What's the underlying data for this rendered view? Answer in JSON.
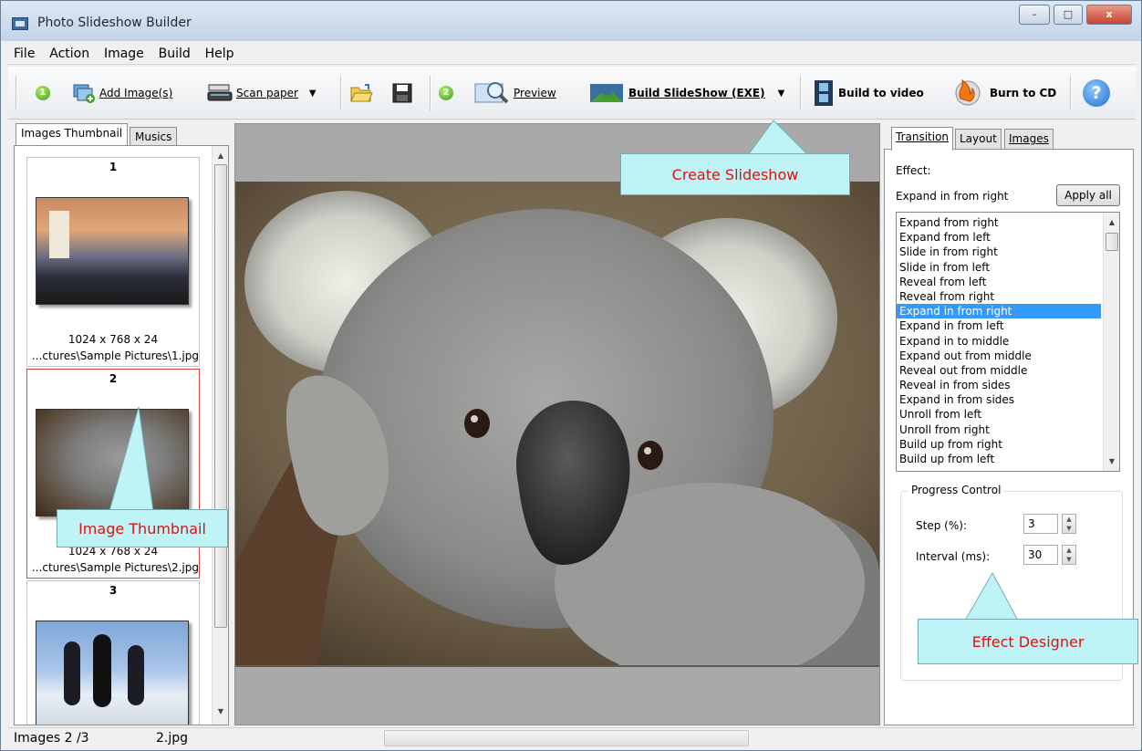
{
  "window": {
    "title": "Photo Slideshow Builder",
    "controls": {
      "minimize": "–",
      "maximize": "□",
      "close": "x"
    }
  },
  "menu": [
    "File",
    "Action",
    "Image",
    "Build",
    "Help"
  ],
  "toolbar": {
    "step1_badge": "1",
    "add_images": "Add Image(s)",
    "scan_paper": "Scan paper",
    "step2_badge": "2",
    "preview": "Preview",
    "build_exe": "Build SlideShow (EXE)",
    "build_video": "Build to video",
    "burn_cd": "Burn to CD",
    "help": "?"
  },
  "left_panel": {
    "tabs": [
      "Images Thumbnail",
      "Musics"
    ],
    "thumbnails": [
      {
        "num": "1",
        "size": "1024 x 768 x 24",
        "path": "...ctures\\Sample Pictures\\1.jpg"
      },
      {
        "num": "2",
        "size": "1024 x 768 x 24",
        "path": "...ctures\\Sample Pictures\\2.jpg"
      },
      {
        "num": "3",
        "size": "",
        "path": ""
      }
    ]
  },
  "right_panel": {
    "tabs": [
      "Transition",
      "Layout",
      "Images"
    ],
    "effect_label": "Effect:",
    "current_effect": "Expand in from right",
    "apply_all": "Apply all",
    "effects": [
      "Expand from right",
      "Expand from left",
      "Slide in from right",
      "Slide in from left",
      "Reveal from left",
      "Reveal from right",
      "Expand in from right",
      "Expand in from left",
      "Expand in to middle",
      "Expand out from middle",
      "Reveal out from middle",
      "Reveal in from sides",
      "Expand in from sides",
      "Unroll from left",
      "Unroll from right",
      "Build up from right",
      "Build up from left"
    ],
    "selected_index": 6,
    "progress": {
      "title": "Progress Control",
      "step_label": "Step (%):",
      "step_value": "3",
      "interval_label": "Interval (ms):",
      "interval_value": "30"
    }
  },
  "status": {
    "images": "Images 2 /3",
    "file": "2.jpg"
  },
  "callouts": {
    "create": "Create Slideshow",
    "thumbnail": "Image Thumbnail",
    "effect": "Effect Designer"
  }
}
